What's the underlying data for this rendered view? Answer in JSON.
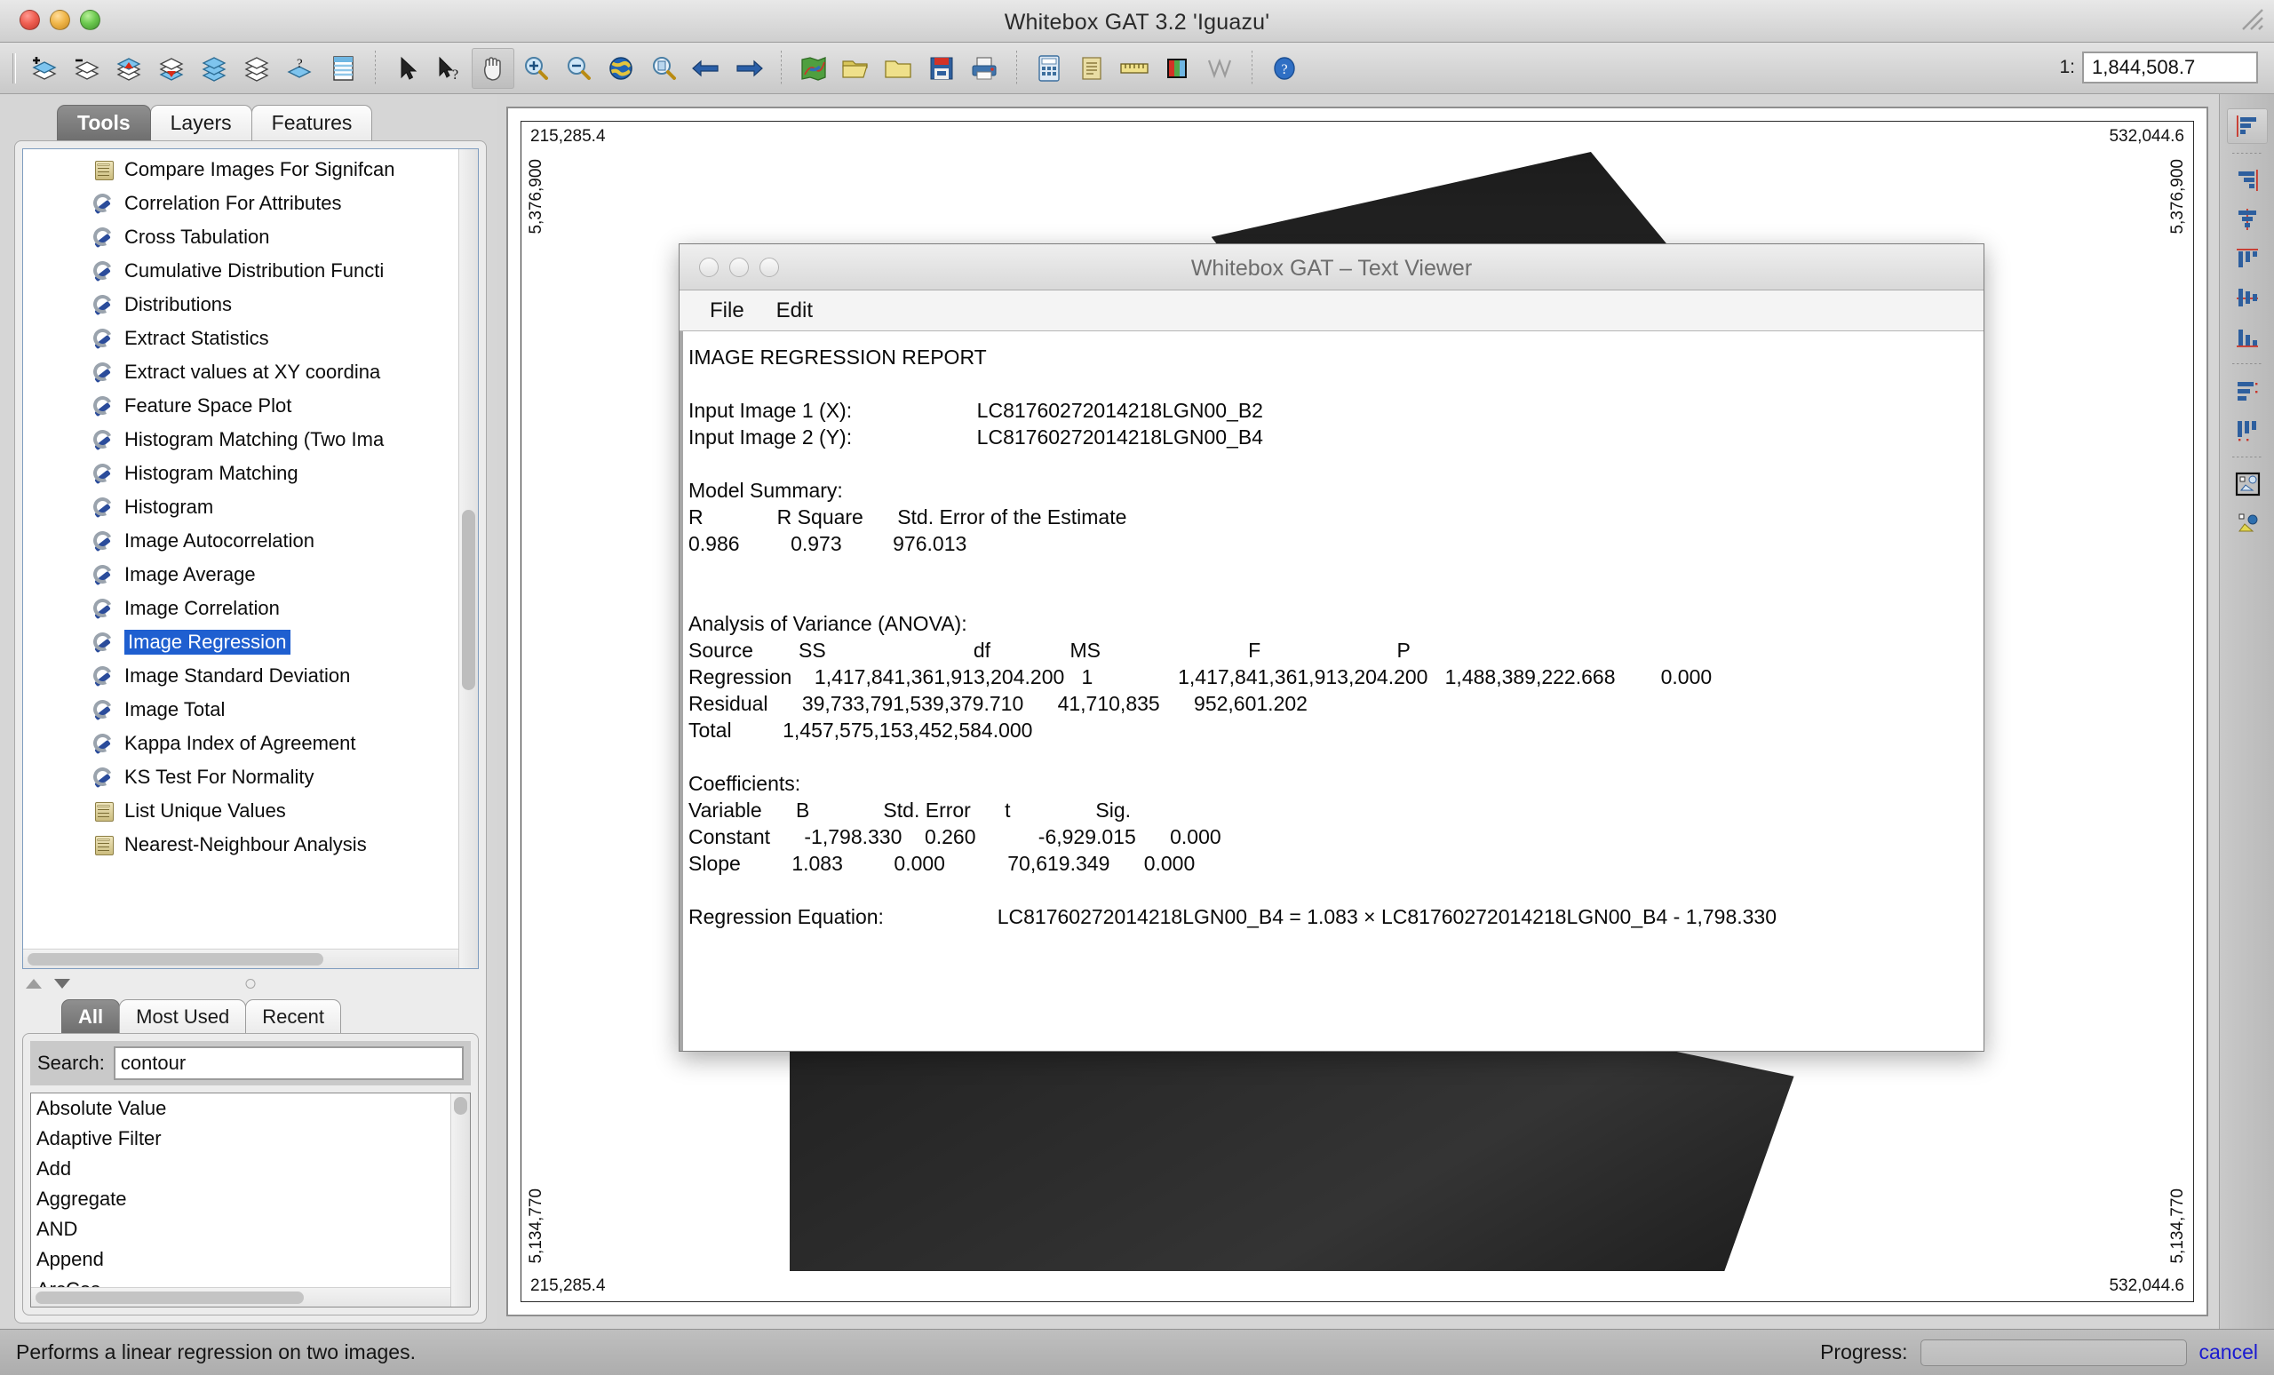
{
  "window": {
    "title": "Whitebox GAT 3.2 'Iguazu'",
    "traffic_lights": [
      "close",
      "minimize",
      "zoom"
    ]
  },
  "toolbar": {
    "groups": [
      {
        "name": "layers",
        "buttons": [
          {
            "icon": "add-layer-icon",
            "label": "Add Layer"
          },
          {
            "icon": "remove-layer-icon",
            "label": "Remove Layer"
          },
          {
            "icon": "raise-layer-icon",
            "label": "Raise Layer"
          },
          {
            "icon": "lower-layer-icon",
            "label": "Lower Layer"
          },
          {
            "icon": "show-all-layers-icon",
            "label": "Show All Layers"
          },
          {
            "icon": "hide-all-layers-icon",
            "label": "Hide All Layers"
          },
          {
            "icon": "layer-properties-icon",
            "label": "Layer Properties"
          },
          {
            "icon": "attribute-table-icon",
            "label": "Attribute Table"
          }
        ]
      },
      {
        "name": "pointer",
        "buttons": [
          {
            "icon": "select-arrow-icon",
            "label": "Select"
          },
          {
            "icon": "select-info-icon",
            "label": "Feature Info"
          }
        ]
      },
      {
        "name": "navigation",
        "buttons": [
          {
            "icon": "pan-hand-icon",
            "label": "Pan",
            "active": true
          },
          {
            "icon": "zoom-in-icon",
            "label": "Zoom In"
          },
          {
            "icon": "zoom-out-icon",
            "label": "Zoom Out"
          },
          {
            "icon": "zoom-full-extent-globe-icon",
            "label": "Zoom To Full Extent"
          },
          {
            "icon": "zoom-to-layer-icon",
            "label": "Zoom To Layer"
          },
          {
            "icon": "previous-extent-arrow-icon",
            "label": "Previous Extent"
          },
          {
            "icon": "next-extent-arrow-icon",
            "label": "Next Extent"
          }
        ]
      },
      {
        "name": "file",
        "buttons": [
          {
            "icon": "new-map-icon",
            "label": "New Map"
          },
          {
            "icon": "open-folder-icon",
            "label": "Open"
          },
          {
            "icon": "folder-icon",
            "label": "Open Recent"
          },
          {
            "icon": "save-floppy-icon",
            "label": "Save"
          },
          {
            "icon": "print-icon",
            "label": "Print"
          }
        ]
      },
      {
        "name": "tools",
        "buttons": [
          {
            "icon": "calculator-icon",
            "label": "Raster Calculator"
          },
          {
            "icon": "scripting-scroll-icon",
            "label": "Scripting"
          },
          {
            "icon": "measure-ruler-icon",
            "label": "Measure"
          },
          {
            "icon": "palette-icon",
            "label": "Palette Manager"
          },
          {
            "icon": "chart-icon",
            "label": "Chart"
          }
        ]
      },
      {
        "name": "help",
        "buttons": [
          {
            "icon": "help-question-icon",
            "label": "Help"
          }
        ]
      }
    ],
    "scale": {
      "label": "1:",
      "value": "1,844,508.7"
    }
  },
  "left_panel": {
    "tabs": [
      {
        "label": "Tools",
        "selected": true
      },
      {
        "label": "Layers",
        "selected": false
      },
      {
        "label": "Features",
        "selected": false
      }
    ],
    "tool_list": [
      {
        "label": "Compare Images For Signifcan",
        "icon": "scroll-icon",
        "selected": false
      },
      {
        "label": "Correlation For Attributes",
        "icon": "wrench-icon",
        "selected": false
      },
      {
        "label": "Cross Tabulation",
        "icon": "wrench-icon",
        "selected": false
      },
      {
        "label": "Cumulative Distribution Functi",
        "icon": "wrench-icon",
        "selected": false
      },
      {
        "label": "Distributions",
        "icon": "wrench-icon",
        "selected": false
      },
      {
        "label": "Extract Statistics",
        "icon": "wrench-icon",
        "selected": false
      },
      {
        "label": "Extract values at XY coordina",
        "icon": "wrench-icon",
        "selected": false
      },
      {
        "label": "Feature Space Plot",
        "icon": "wrench-icon",
        "selected": false
      },
      {
        "label": "Histogram Matching (Two Ima",
        "icon": "wrench-icon",
        "selected": false
      },
      {
        "label": "Histogram Matching",
        "icon": "wrench-icon",
        "selected": false
      },
      {
        "label": "Histogram",
        "icon": "wrench-icon",
        "selected": false
      },
      {
        "label": "Image Autocorrelation",
        "icon": "wrench-icon",
        "selected": false
      },
      {
        "label": "Image Average",
        "icon": "wrench-icon",
        "selected": false
      },
      {
        "label": "Image Correlation",
        "icon": "wrench-icon",
        "selected": false
      },
      {
        "label": "Image Regression",
        "icon": "wrench-icon",
        "selected": true
      },
      {
        "label": "Image Standard Deviation",
        "icon": "wrench-icon",
        "selected": false
      },
      {
        "label": "Image Total",
        "icon": "wrench-icon",
        "selected": false
      },
      {
        "label": "Kappa Index of Agreement",
        "icon": "wrench-icon",
        "selected": false
      },
      {
        "label": "KS Test For Normality",
        "icon": "wrench-icon",
        "selected": false
      },
      {
        "label": "List Unique Values",
        "icon": "scroll-icon",
        "selected": false
      },
      {
        "label": "Nearest-Neighbour Analysis",
        "icon": "scroll-icon",
        "selected": false
      }
    ],
    "sub_tabs": [
      {
        "label": "All",
        "selected": true
      },
      {
        "label": "Most Used",
        "selected": false
      },
      {
        "label": "Recent",
        "selected": false
      }
    ],
    "search": {
      "label": "Search:",
      "value": "contour",
      "placeholder": ""
    },
    "results": [
      "Absolute Value",
      "Adaptive Filter",
      "Add",
      "Aggregate",
      "AND",
      "Append",
      "ArcCos"
    ]
  },
  "map": {
    "coord_left": "215,285.4",
    "coord_right": "532,044.6",
    "coord_top": "5,376,900",
    "coord_bottom": "5,134,770"
  },
  "right_toolbar": {
    "buttons": [
      {
        "icon": "align-left-icon",
        "label": "Align Left",
        "active": true
      },
      {
        "icon": "align-right-icon",
        "label": "Align Right"
      },
      {
        "icon": "align-center-horizontal-icon",
        "label": "Center Horizontally"
      },
      {
        "icon": "align-top-icon",
        "label": "Align Top"
      },
      {
        "icon": "align-middle-icon",
        "label": "Align Middle"
      },
      {
        "icon": "align-bottom-icon",
        "label": "Align Bottom"
      },
      {
        "icon": "distribute-vertically-icon",
        "label": "Distribute Vertically"
      },
      {
        "icon": "distribute-horizontally-icon",
        "label": "Distribute Horizontally"
      },
      {
        "icon": "group-elements-icon",
        "label": "Group Elements"
      },
      {
        "icon": "ungroup-elements-icon",
        "label": "Ungroup Elements"
      }
    ]
  },
  "status_bar": {
    "message": "Performs a linear regression on two images.",
    "progress_label": "Progress:",
    "progress_value": 0,
    "cancel_label": "cancel"
  },
  "dialog": {
    "title": "Whitebox GAT – Text Viewer",
    "menus": [
      "File",
      "Edit"
    ],
    "report": {
      "heading": "IMAGE REGRESSION REPORT",
      "input_image_1_label": "Input Image 1 (X):",
      "input_image_1_value": "LC81760272014218LGN00_B2",
      "input_image_2_label": "Input Image 2 (Y):",
      "input_image_2_value": "LC81760272014218LGN00_B4",
      "model_summary_label": "Model Summary:",
      "model_summary_headers": [
        "R",
        "R Square",
        "Std. Error of the Estimate"
      ],
      "model_summary_values": [
        "0.986",
        "0.973",
        "976.013"
      ],
      "anova_label": "Analysis of Variance (ANOVA):",
      "anova_headers": [
        "Source",
        "SS",
        "df",
        "MS",
        "F",
        "P"
      ],
      "anova_rows": [
        [
          "Regression",
          "1,417,841,361,913,204.200",
          "1",
          "1,417,841,361,913,204.200",
          "1,488,389,222.668",
          "0.000"
        ],
        [
          "Residual",
          "39,733,791,539,379.710",
          "41,710,835",
          "952,601.202",
          "",
          ""
        ],
        [
          "Total",
          "1,457,575,153,452,584.000",
          "",
          "",
          "",
          ""
        ]
      ],
      "coefficients_label": "Coefficients:",
      "coefficients_headers": [
        "Variable",
        "B",
        "Std. Error",
        "t",
        "Sig."
      ],
      "coefficients_rows": [
        [
          "Constant",
          "-1,798.330",
          "0.260",
          "-6,929.015",
          "0.000"
        ],
        [
          "Slope",
          "1.083",
          "0.000",
          "70,619.349",
          "0.000"
        ]
      ],
      "equation_label": "Regression Equation:",
      "equation_value": "LC81760272014218LGN00_B4 = 1.083 × LC81760272014218LGN00_B4 - 1,798.330",
      "body_text": "IMAGE REGRESSION REPORT\n\nInput Image 1 (X):                      LC81760272014218LGN00_B2\nInput Image 2 (Y):                      LC81760272014218LGN00_B4\n\nModel Summary:\nR             R Square      Std. Error of the Estimate\n0.986         0.973         976.013\n\n\nAnalysis of Variance (ANOVA):\nSource        SS                          df              MS                          F                        P\nRegression    1,417,841,361,913,204.200   1               1,417,841,361,913,204.200   1,488,389,222.668        0.000\nResidual      39,733,791,539,379.710      41,710,835      952,601.202\nTotal         1,457,575,153,452,584.000\n\nCoefficients:\nVariable      B             Std. Error      t               Sig.\nConstant      -1,798.330    0.260           -6,929.015      0.000\nSlope         1.083         0.000           70,619.349      0.000\n\nRegression Equation:                    LC81760272014218LGN00_B4 = 1.083 × LC81760272014218LGN00_B4 - 1,798.330"
    }
  }
}
